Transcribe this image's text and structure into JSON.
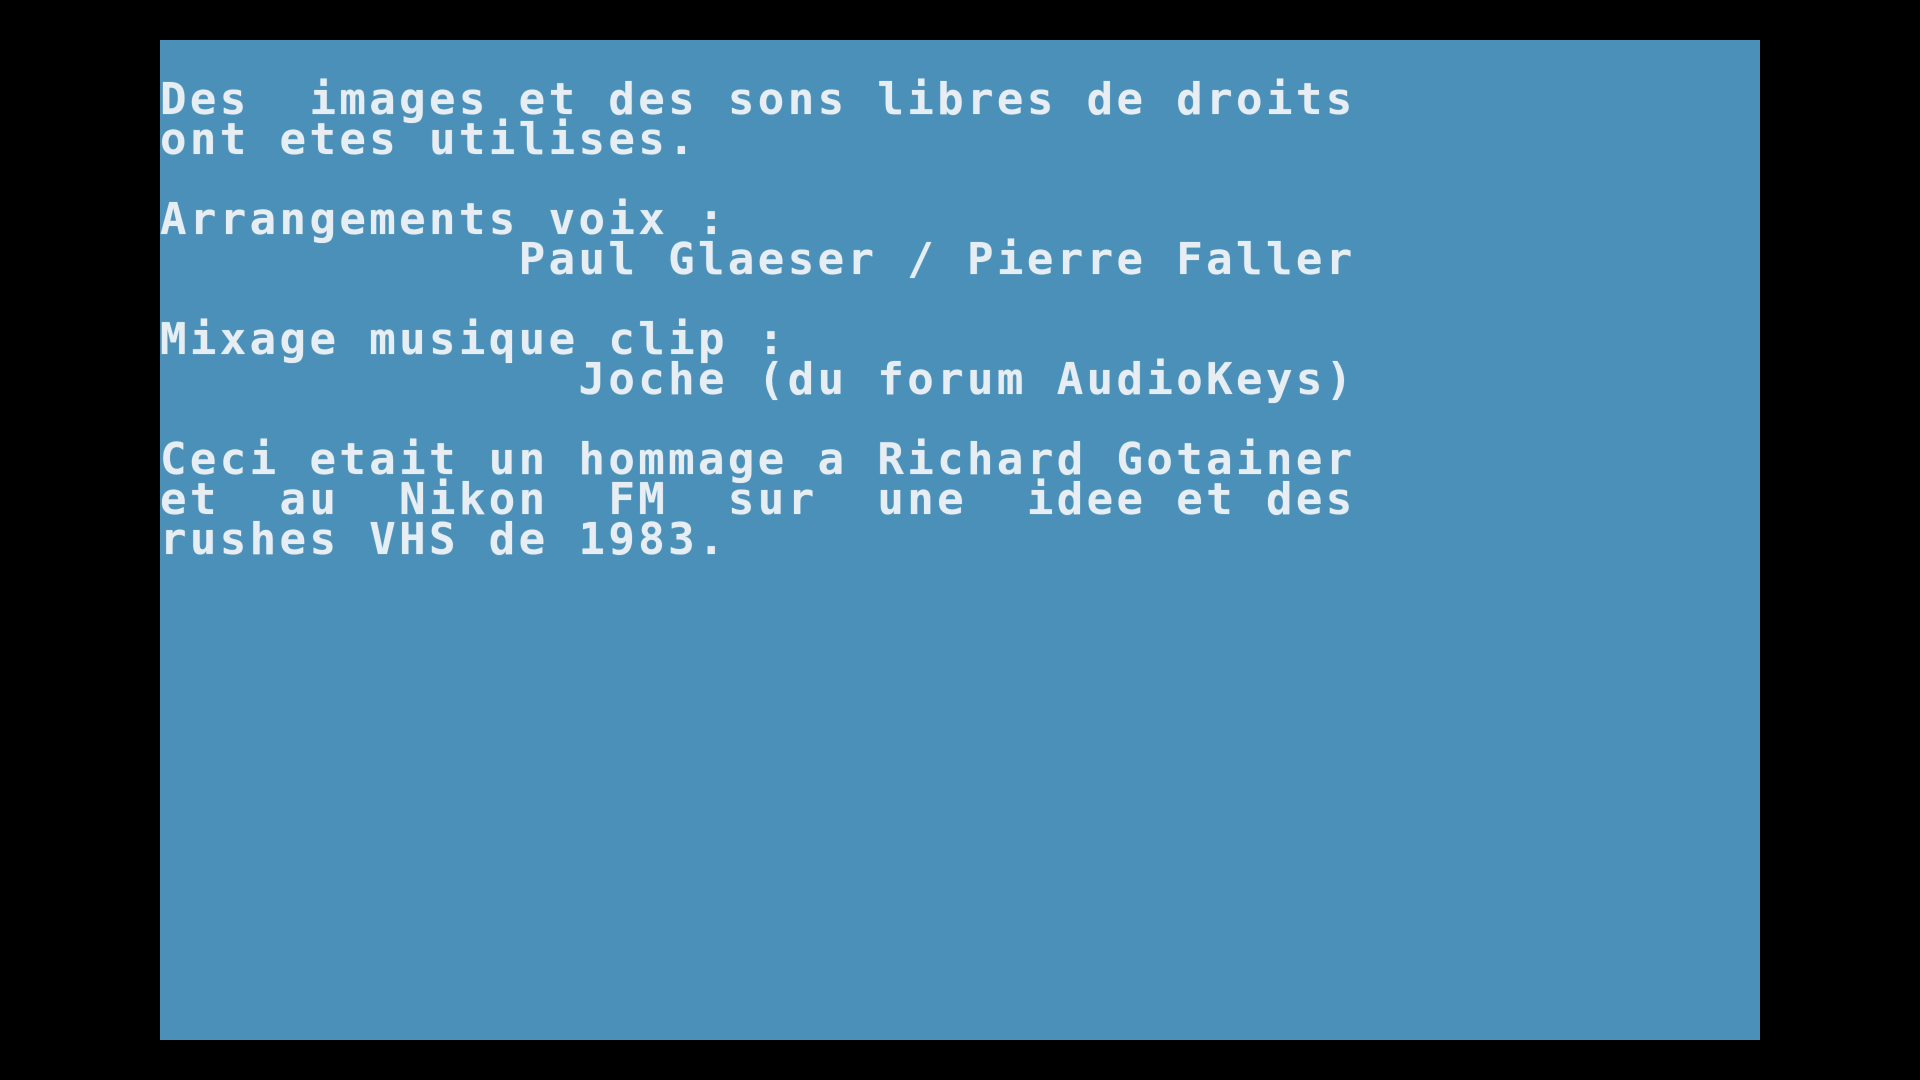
{
  "screen": {
    "background_color": "#4A90B8",
    "border_color": "#000000",
    "text_color": "#E6EEF4"
  },
  "credits": {
    "lines": [
      "Des  images et des sons libres de droits",
      "ont etes utilises.",
      "Arrangements voix :",
      "            Paul Glaeser / Pierre Faller",
      "Mixage musique clip :",
      "              Joche (du forum AudioKeys)",
      "Ceci etait un hommage a Richard Gotainer",
      "et  au  Nikon  FM  sur  une  idee et des",
      "rushes VHS de 1983."
    ]
  }
}
